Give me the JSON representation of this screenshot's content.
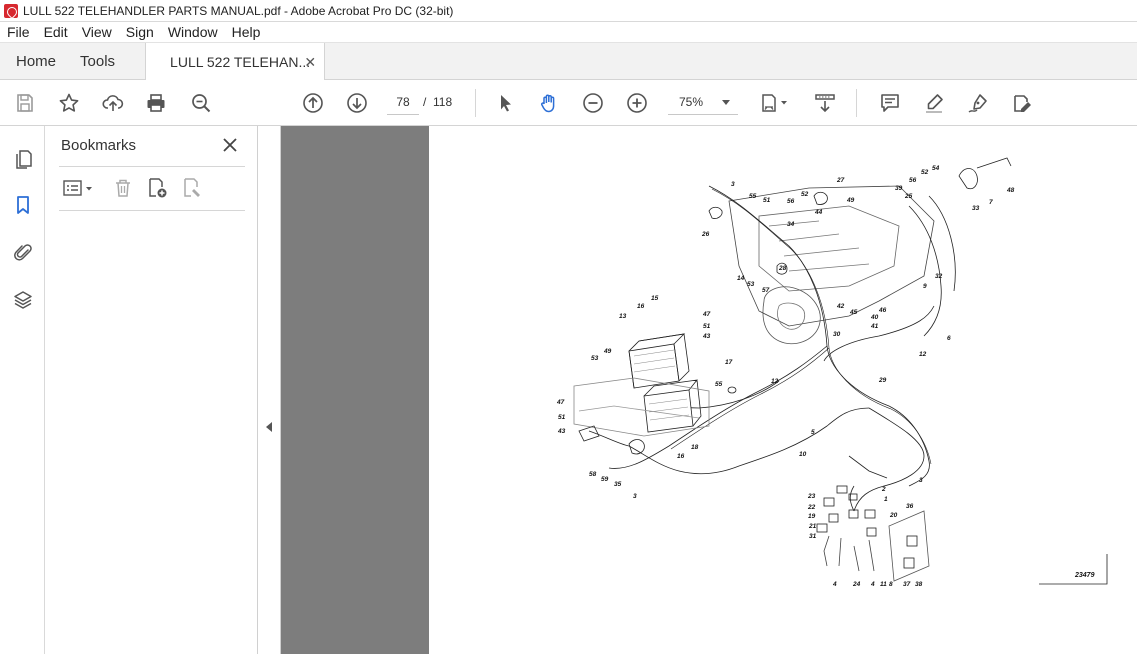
{
  "window": {
    "title": "LULL 522 TELEHANDLER PARTS MANUAL.pdf - Adobe Acrobat Pro DC (32-bit)"
  },
  "menu": [
    "File",
    "Edit",
    "View",
    "Sign",
    "Window",
    "Help"
  ],
  "tabs": {
    "home": "Home",
    "tools": "Tools",
    "document": "LULL 522 TELEHAN..."
  },
  "toolbar": {
    "current_page": "78",
    "page_separator": "/",
    "total_pages": "118",
    "zoom": "75%"
  },
  "bookmarks": {
    "title": "Bookmarks"
  },
  "diagram": {
    "figure_number": "23479",
    "labels": [
      "3",
      "55",
      "51",
      "26",
      "52",
      "56",
      "27",
      "44",
      "34",
      "49",
      "39",
      "25",
      "52",
      "54",
      "56",
      "33",
      "7",
      "48",
      "14",
      "28",
      "53",
      "57",
      "32",
      "9",
      "42",
      "46",
      "45",
      "40",
      "41",
      "30",
      "29",
      "12",
      "12",
      "6",
      "15",
      "16",
      "13",
      "47",
      "51",
      "43",
      "49",
      "53",
      "17",
      "55",
      "47",
      "51",
      "43",
      "18",
      "16",
      "58",
      "59",
      "35",
      "3",
      "5",
      "10",
      "3",
      "1",
      "2",
      "23",
      "22",
      "19",
      "21",
      "31",
      "20",
      "36",
      "4",
      "24",
      "4",
      "11",
      "8",
      "37",
      "38"
    ]
  },
  "icons": {
    "save": "save-icon",
    "star": "star-icon",
    "upload": "upload-cloud-icon",
    "print": "print-icon",
    "zoom_search": "search-zoom-icon",
    "prev_page": "arrow-up-circle-icon",
    "next_page": "arrow-down-circle-icon",
    "select": "cursor-arrow-icon",
    "hand": "hand-icon",
    "zoom_out": "minus-circle-icon",
    "zoom_in": "plus-circle-icon",
    "fit": "fit-page-icon",
    "scroll": "scroll-mode-icon",
    "comment": "comment-icon",
    "highlight": "highlight-pen-icon",
    "sign": "sign-pen-icon",
    "edit": "edit-pdf-icon",
    "pages": "page-thumbnails-icon",
    "bookmarks": "bookmark-icon",
    "attachments": "paperclip-icon",
    "layers": "layers-icon"
  },
  "colors": {
    "accent": "#2d6fd6",
    "acrobat_red": "#d7282f",
    "doc_background": "#7d7d7d"
  }
}
